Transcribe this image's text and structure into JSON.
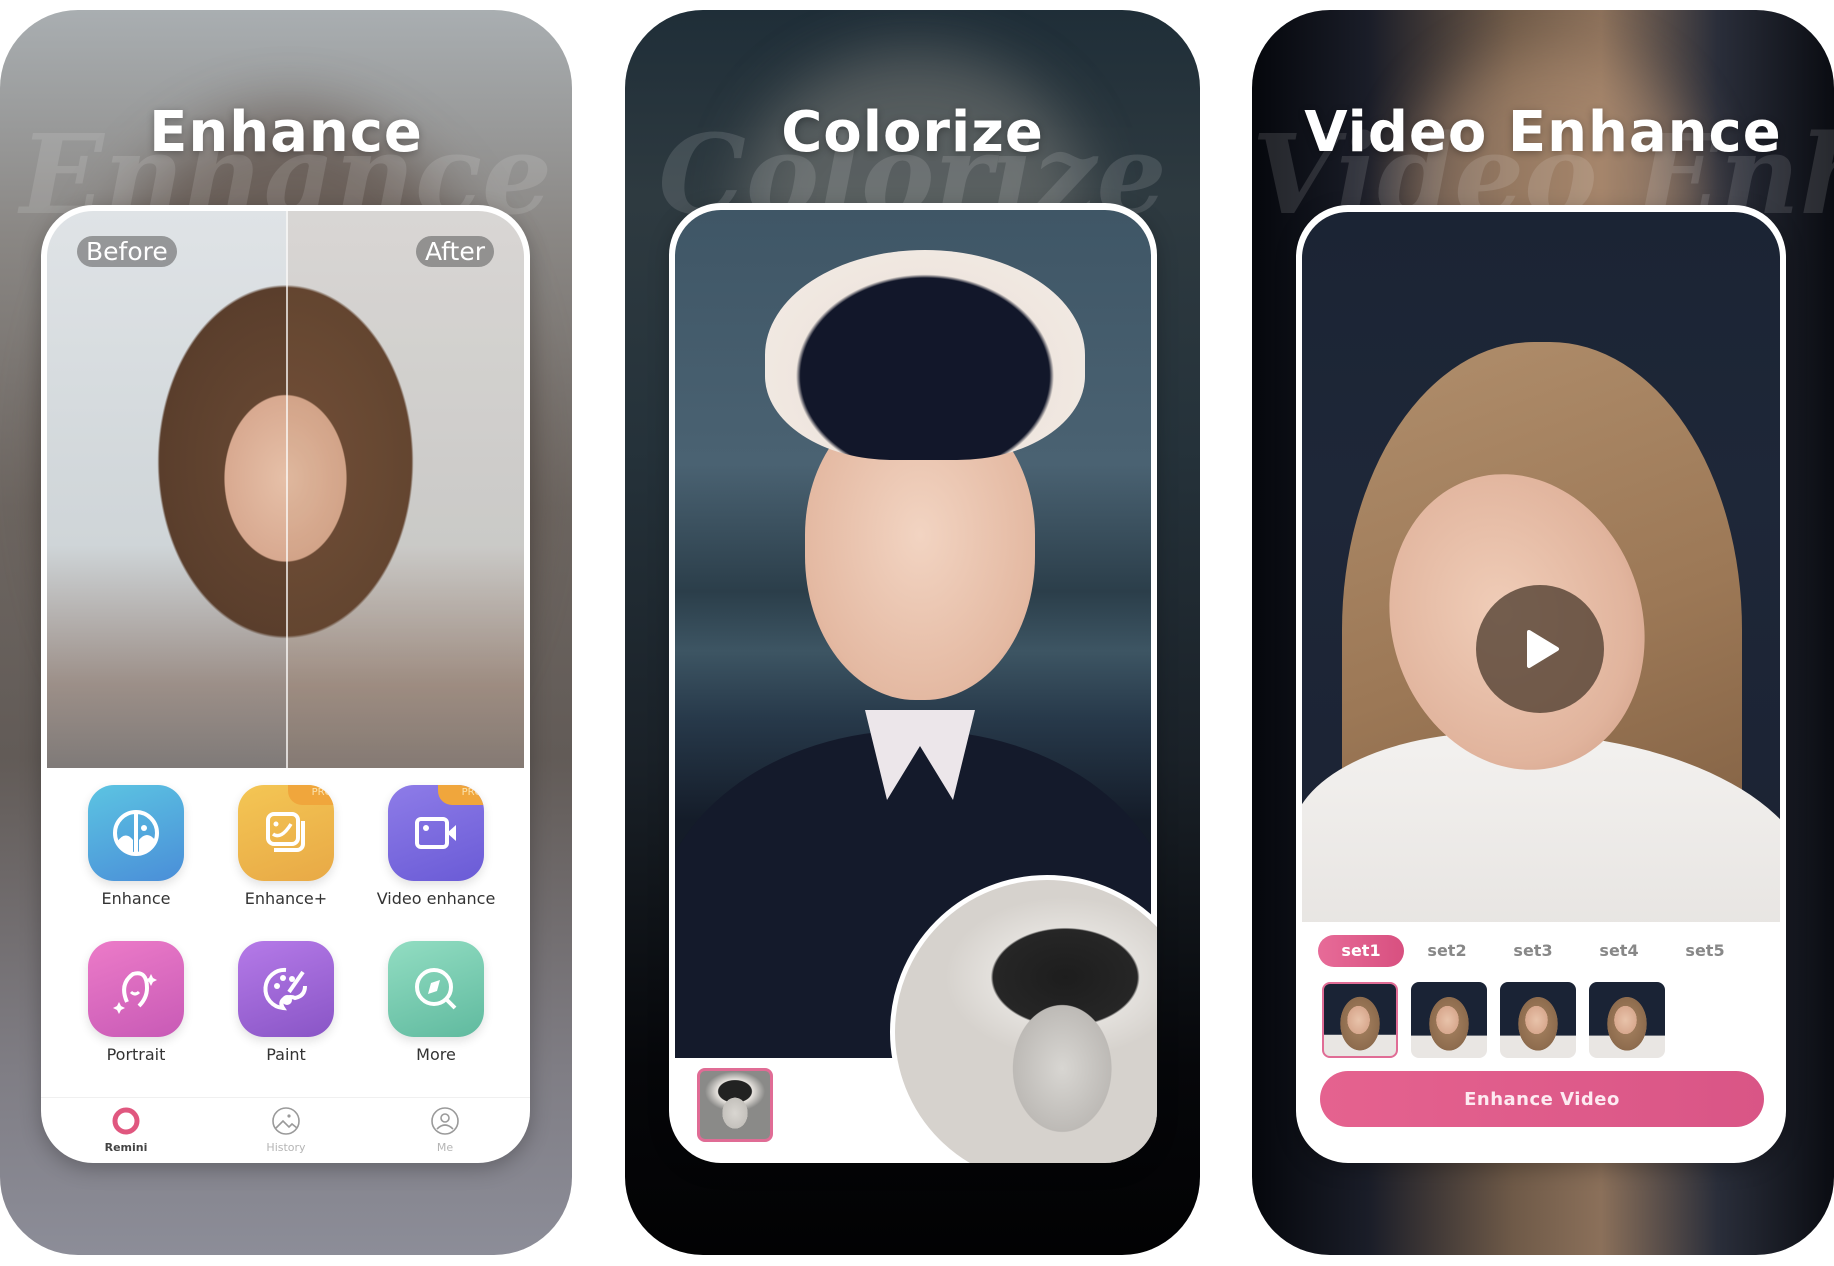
{
  "panels": [
    {
      "title": "Enhance",
      "ghost_text": "Enhance",
      "card": {
        "compare_labels": {
          "before": "Before",
          "after": "After"
        },
        "features": [
          {
            "label": "Enhance",
            "icon": "face-half-icon",
            "pro": false,
            "color_from": "#5bc0e0",
            "color_to": "#4a8fd8"
          },
          {
            "label": "Enhance+",
            "icon": "photo-stack-icon",
            "pro": true,
            "color_from": "#f3c452",
            "color_to": "#e9a947"
          },
          {
            "label": "Video enhance",
            "icon": "video-camera-icon",
            "pro": true,
            "color_from": "#8c7ae6",
            "color_to": "#6a5cd6"
          },
          {
            "label": "Portrait",
            "icon": "portrait-icon",
            "pro": false,
            "color_from": "#ea78c6",
            "color_to": "#c95bb8"
          },
          {
            "label": "Paint",
            "icon": "palette-icon",
            "pro": false,
            "color_from": "#b67ae8",
            "color_to": "#8a55c8"
          },
          {
            "label": "More",
            "icon": "compass-search-icon",
            "pro": false,
            "color_from": "#8fdcc0",
            "color_to": "#62bba0"
          }
        ],
        "pro_badge": "PRO",
        "tabs": [
          {
            "label": "Remini",
            "icon": "remini-ring-icon",
            "active": true
          },
          {
            "label": "History",
            "icon": "history-landscape-icon",
            "active": false
          },
          {
            "label": "Me",
            "icon": "user-icon",
            "active": false
          }
        ]
      }
    },
    {
      "title": "Colorize",
      "ghost_text": "Colorize"
    },
    {
      "title": "Video Enhance",
      "ghost_text": "Video Enhance",
      "card": {
        "sets": [
          "set1",
          "set2",
          "set3",
          "set4",
          "set5"
        ],
        "active_set": "set1",
        "thumbnail_count": 4,
        "button_label": "Enhance Video"
      }
    }
  ],
  "colors": {
    "accent_pink": "#e15c8c",
    "pro_orange": "#f0a63c"
  }
}
